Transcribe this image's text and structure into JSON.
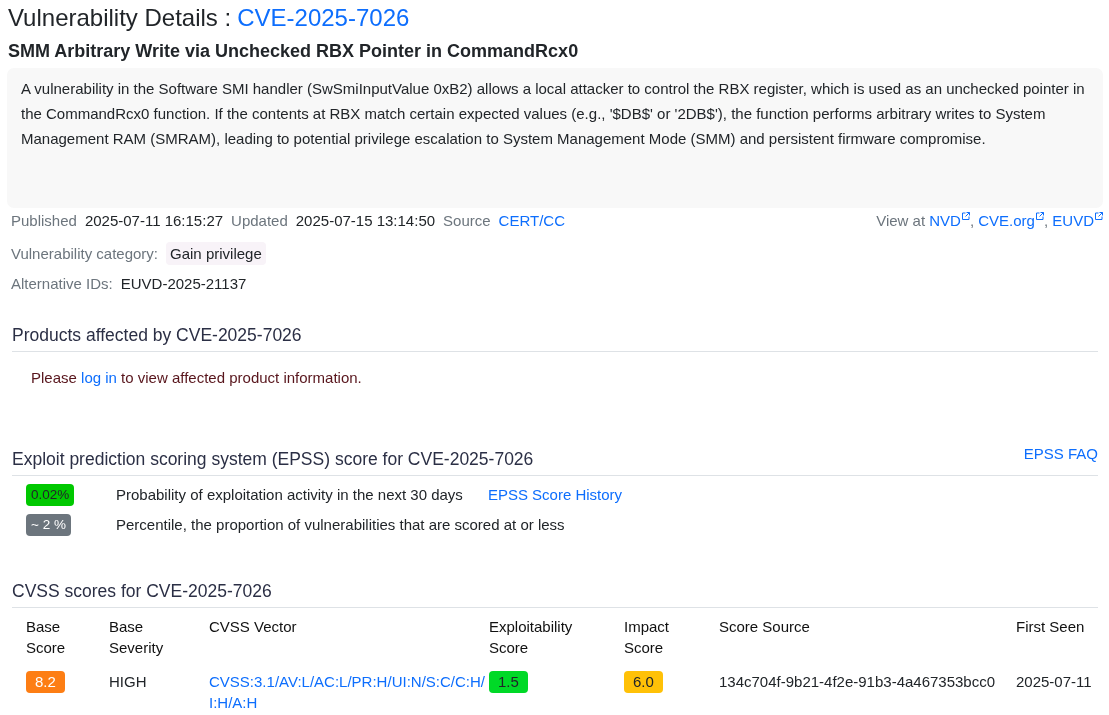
{
  "header": {
    "title": "Vulnerability Details :",
    "cve_id": "CVE-2025-7026",
    "subtitle": "SMM Arbitrary Write via Unchecked RBX Pointer in CommandRcx0"
  },
  "description": "A vulnerability in the Software SMI handler (SwSmiInputValue 0xB2) allows a local attacker to control the RBX register, which is used as an unchecked pointer in the CommandRcx0 function. If the contents at RBX match certain expected values (e.g., '$DB$' or '2DB$'), the function performs arbitrary writes to System Management RAM (SMRAM), leading to potential privilege escalation to System Management Mode (SMM) and persistent firmware compromise.",
  "meta": {
    "fields": [
      {
        "label": "Published",
        "value": "2025-07-11 16:15:27",
        "kind": "text"
      },
      {
        "label": "Updated",
        "value": "2025-07-15 13:14:50",
        "kind": "text"
      },
      {
        "label": "Source",
        "value": "CERT/CC",
        "kind": "link"
      }
    ],
    "view_at": {
      "label": "View at",
      "links": [
        {
          "label": "NVD",
          "separator": ","
        },
        {
          "label": "CVE.org",
          "separator": ","
        },
        {
          "label": "EUVD"
        }
      ]
    }
  },
  "category": {
    "label": "Vulnerability category:",
    "tags": [
      "Gain privilege"
    ]
  },
  "alternative_ids": {
    "label": "Alternative IDs:",
    "values": [
      "EUVD-2025-21137"
    ]
  },
  "products": {
    "heading": "Products affected by CVE-2025-7026",
    "notice": {
      "before": "Please",
      "link": "log in",
      "after": "to view affected product information."
    }
  },
  "epss": {
    "heading": "Exploit prediction scoring system (EPSS) score for CVE-2025-7026",
    "faq_link": "EPSS FAQ",
    "rows": [
      {
        "badge": "0.02%",
        "color": "#00c800",
        "text": "Probability of exploitation activity in the next 30 days",
        "link": "EPSS Score History"
      },
      {
        "badge": "~ 2 %",
        "color": "#6c757d",
        "text": "Percentile, the proportion of vulnerabilities that are scored at or less"
      }
    ]
  },
  "cvss": {
    "heading": "CVSS scores for CVE-2025-7026",
    "columns": [
      "Base Score",
      "Base Severity",
      "CVSS Vector",
      "Exploitability Score",
      "Impact Score",
      "Score Source",
      "First Seen"
    ],
    "rows": [
      {
        "base_score": {
          "value": "8.2",
          "color": "#fd7e14"
        },
        "base_severity": "HIGH",
        "cvss_vector": "CVSS:3.1/AV:L/AC:L/PR:H/UI:N/S:C/C:H/I:H/A:H",
        "exploitability_score": {
          "value": "1.5",
          "color": "#00d927"
        },
        "impact_score": {
          "value": "6.0",
          "color": "#ffc107"
        },
        "score_source": "134c704f-9b21-4f2e-91b3-4a467353bcc0",
        "first_seen": "2025-07-11"
      }
    ]
  }
}
